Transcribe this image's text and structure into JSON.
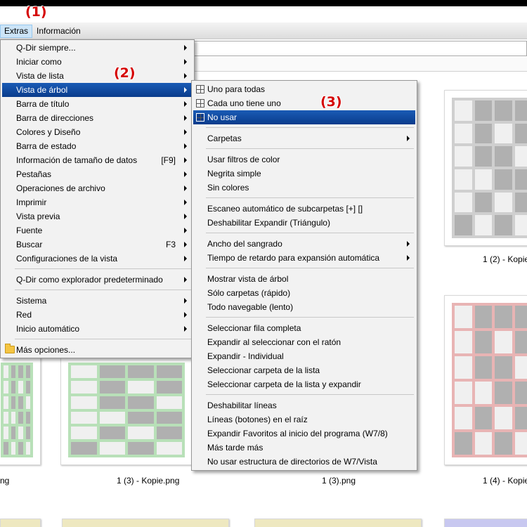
{
  "menubar": {
    "extras": "Extras",
    "informacion": "Información"
  },
  "annotations": {
    "a1": "(1)",
    "a2": "(2)",
    "a3": "(3)"
  },
  "captions": {
    "c1": "1 (2) - Kopie",
    "c2": "ng",
    "c3": "1 (3) - Kopie.png",
    "c4": "1 (3).png",
    "c5": "1 (4) - Kopie"
  },
  "main_menu": {
    "items": [
      {
        "label": "Q-Dir siempre...",
        "arrow": true
      },
      {
        "label": "Iniciar como",
        "arrow": true
      },
      {
        "label": "Vista de lista",
        "arrow": true
      },
      {
        "label": "Vista de árbol",
        "arrow": true,
        "highlight": true
      },
      {
        "label": "Barra de título",
        "arrow": true
      },
      {
        "label": "Barra de direcciones",
        "arrow": true
      },
      {
        "label": "Colores y Diseño",
        "arrow": true
      },
      {
        "label": "Barra de estado",
        "arrow": true
      },
      {
        "label": "Información de tamaño de datos",
        "shortcut": "[F9]",
        "arrow": true
      },
      {
        "label": "Pestañas",
        "arrow": true
      },
      {
        "label": "Operaciones de archivo",
        "arrow": true
      },
      {
        "label": "Imprimir",
        "arrow": true
      },
      {
        "label": "Vista previa",
        "arrow": true
      },
      {
        "label": "Fuente",
        "arrow": true
      },
      {
        "label": "Buscar",
        "shortcut": "F3",
        "arrow": true
      },
      {
        "label": "Configuraciones de la vista",
        "arrow": true
      },
      {
        "label": "Q-Dir como explorador predeterminado",
        "arrow": true,
        "sep_before": true
      },
      {
        "label": "Sistema",
        "arrow": true,
        "sep_before": true
      },
      {
        "label": "Red",
        "arrow": true
      },
      {
        "label": "Inicio automático",
        "arrow": true
      },
      {
        "label": "Más opciones...",
        "icon": "folder-icon",
        "sep_before": true
      }
    ]
  },
  "sub_menu": {
    "items": [
      {
        "label": "Uno para todas",
        "icon": "tree-icon"
      },
      {
        "label": "Cada uno tiene uno",
        "icon": "tree-icon"
      },
      {
        "label": "No usar",
        "icon": "tree-icon",
        "highlight": true
      },
      {
        "label": "Carpetas",
        "arrow": true,
        "sep_before": true
      },
      {
        "label": "Usar filtros de color",
        "sep_before": true
      },
      {
        "label": "Negrita simple"
      },
      {
        "label": "Sin colores"
      },
      {
        "label": "Escaneo automático de subcarpetas [+] []",
        "sep_before": true
      },
      {
        "label": "Deshabilitar Expandir (Triángulo)"
      },
      {
        "label": "Ancho del sangrado",
        "arrow": true,
        "sep_before": true
      },
      {
        "label": "Tiempo de retardo para expansión automática",
        "arrow": true
      },
      {
        "label": "Mostrar vista de árbol",
        "sep_before": true
      },
      {
        "label": "Sólo carpetas (rápido)"
      },
      {
        "label": "Todo navegable (lento)"
      },
      {
        "label": "Seleccionar fila completa",
        "sep_before": true
      },
      {
        "label": "Expandir al seleccionar con el ratón"
      },
      {
        "label": "Expandir - Individual"
      },
      {
        "label": "Seleccionar carpeta de la lista"
      },
      {
        "label": "Seleccionar carpeta de la lista y expandir"
      },
      {
        "label": "Deshabilitar líneas",
        "sep_before": true
      },
      {
        "label": "Líneas (botones) en el raíz"
      },
      {
        "label": "Expandir Favoritos al inicio del programa (W7/8)"
      },
      {
        "label": "Más tarde más"
      },
      {
        "label": "No usar estructura de directorios de W7/Vista"
      }
    ]
  },
  "colors": {
    "highlight": "#0a3c8c",
    "annotation": "#d50000"
  }
}
